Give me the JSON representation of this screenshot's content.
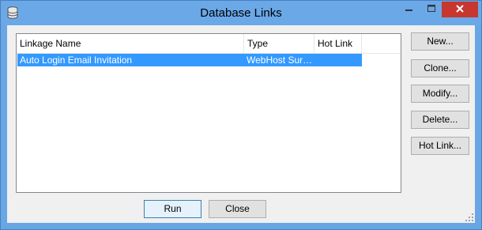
{
  "window": {
    "title": "Database Links",
    "icon": "database-icon"
  },
  "titlebar_controls": {
    "minimize_icon": "minimize-icon",
    "maximize_icon": "maximize-icon",
    "close_icon": "close-icon",
    "close_color": "#c7372f"
  },
  "list": {
    "columns": [
      "Linkage Name",
      "Type",
      "Hot Link"
    ],
    "rows": [
      {
        "name": "Auto Login Email Invitation",
        "type": "WebHost Sur…",
        "hot_link": "",
        "selected": true
      }
    ],
    "selection_color": "#3399ff"
  },
  "side_buttons": {
    "new": "New...",
    "clone": "Clone...",
    "modify": "Modify...",
    "delete": "Delete...",
    "hot_link": "Hot Link..."
  },
  "bottom_buttons": {
    "run": "Run",
    "close": "Close"
  },
  "colors": {
    "titlebar": "#6aa8e8",
    "dialog_bg": "#f0f0f0"
  }
}
